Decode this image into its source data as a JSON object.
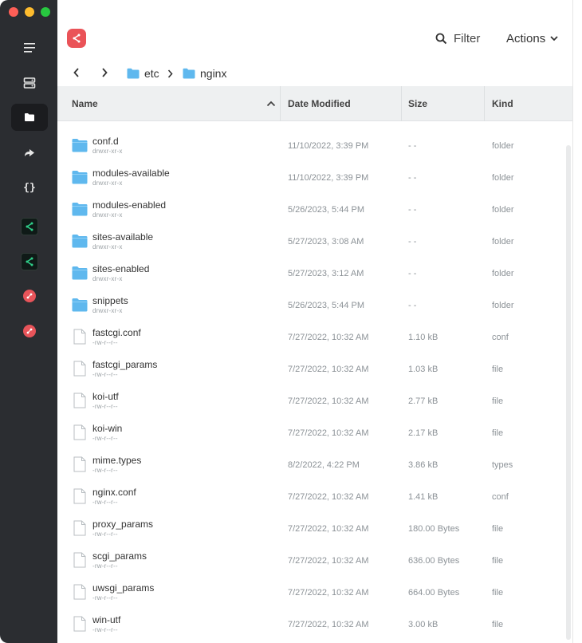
{
  "toolbar": {
    "filter_label": "Filter",
    "actions_label": "Actions",
    "icons": {
      "filter": "search-icon",
      "actions": "chevron-down-icon",
      "logo": "ubuntu-logo-icon"
    }
  },
  "sidebar": {
    "items": [
      {
        "name": "menu",
        "icon": "hamburger-icon"
      },
      {
        "name": "hosts",
        "icon": "server-icon"
      },
      {
        "name": "sftp",
        "icon": "folder-icon",
        "active": true
      },
      {
        "name": "port-forwarding",
        "icon": "forward-arrow-icon"
      },
      {
        "name": "snippets",
        "icon": "braces-icon"
      },
      {
        "name": "host-ubuntu-1",
        "icon": "ubuntu-icon"
      },
      {
        "name": "host-ubuntu-2",
        "icon": "ubuntu-icon"
      },
      {
        "name": "host-red-1",
        "icon": "red-host-icon"
      },
      {
        "name": "host-red-2",
        "icon": "red-host-icon"
      }
    ]
  },
  "breadcrumb": [
    "etc",
    "nginx"
  ],
  "columns": {
    "name": "Name",
    "date": "Date Modified",
    "size": "Size",
    "kind": "Kind"
  },
  "files": [
    {
      "name": "conf.d",
      "perm": "drwxr-xr-x",
      "date": "11/10/2022, 3:39 PM",
      "size": "- -",
      "kind": "folder",
      "type": "folder"
    },
    {
      "name": "modules-available",
      "perm": "drwxr-xr-x",
      "date": "11/10/2022, 3:39 PM",
      "size": "- -",
      "kind": "folder",
      "type": "folder"
    },
    {
      "name": "modules-enabled",
      "perm": "drwxr-xr-x",
      "date": "5/26/2023, 5:44 PM",
      "size": "- -",
      "kind": "folder",
      "type": "folder"
    },
    {
      "name": "sites-available",
      "perm": "drwxr-xr-x",
      "date": "5/27/2023, 3:08 AM",
      "size": "- -",
      "kind": "folder",
      "type": "folder"
    },
    {
      "name": "sites-enabled",
      "perm": "drwxr-xr-x",
      "date": "5/27/2023, 3:12 AM",
      "size": "- -",
      "kind": "folder",
      "type": "folder"
    },
    {
      "name": "snippets",
      "perm": "drwxr-xr-x",
      "date": "5/26/2023, 5:44 PM",
      "size": "- -",
      "kind": "folder",
      "type": "folder"
    },
    {
      "name": "fastcgi.conf",
      "perm": "-rw-r--r--",
      "date": "7/27/2022, 10:32 AM",
      "size": "1.10 kB",
      "kind": "conf",
      "type": "file"
    },
    {
      "name": "fastcgi_params",
      "perm": "-rw-r--r--",
      "date": "7/27/2022, 10:32 AM",
      "size": "1.03 kB",
      "kind": "file",
      "type": "file"
    },
    {
      "name": "koi-utf",
      "perm": "-rw-r--r--",
      "date": "7/27/2022, 10:32 AM",
      "size": "2.77 kB",
      "kind": "file",
      "type": "file"
    },
    {
      "name": "koi-win",
      "perm": "-rw-r--r--",
      "date": "7/27/2022, 10:32 AM",
      "size": "2.17 kB",
      "kind": "file",
      "type": "file"
    },
    {
      "name": "mime.types",
      "perm": "-rw-r--r--",
      "date": "8/2/2022, 4:22 PM",
      "size": "3.86 kB",
      "kind": "types",
      "type": "file"
    },
    {
      "name": "nginx.conf",
      "perm": "-rw-r--r--",
      "date": "7/27/2022, 10:32 AM",
      "size": "1.41 kB",
      "kind": "conf",
      "type": "file"
    },
    {
      "name": "proxy_params",
      "perm": "-rw-r--r--",
      "date": "7/27/2022, 10:32 AM",
      "size": "180.00 Bytes",
      "kind": "file",
      "type": "file"
    },
    {
      "name": "scgi_params",
      "perm": "-rw-r--r--",
      "date": "7/27/2022, 10:32 AM",
      "size": "636.00 Bytes",
      "kind": "file",
      "type": "file"
    },
    {
      "name": "uwsgi_params",
      "perm": "-rw-r--r--",
      "date": "7/27/2022, 10:32 AM",
      "size": "664.00 Bytes",
      "kind": "file",
      "type": "file"
    },
    {
      "name": "win-utf",
      "perm": "-rw-r--r--",
      "date": "7/27/2022, 10:32 AM",
      "size": "3.00 kB",
      "kind": "file",
      "type": "file"
    }
  ],
  "colors": {
    "sidebar_bg": "#2b2d31",
    "folder": "#5fb8ee",
    "accent_red": "#ea5358",
    "ubuntu_green": "#2fd08a"
  }
}
